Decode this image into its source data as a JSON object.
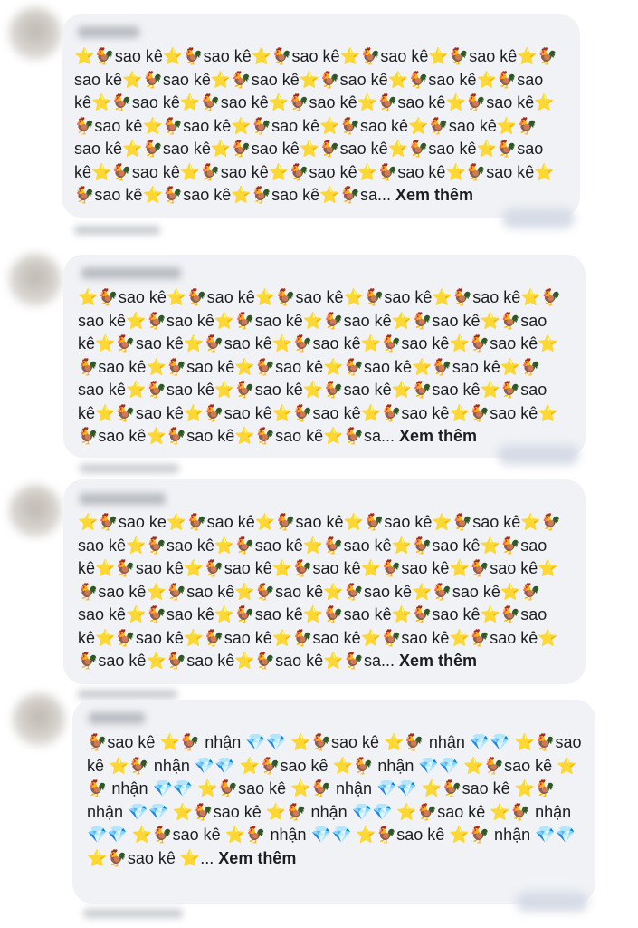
{
  "comments": [
    {
      "text": "⭐🐓sao kê⭐🐓sao kê⭐🐓sao kê⭐🐓sao kê⭐🐓sao kê⭐🐓sao kê⭐🐓sao kê⭐🐓sao kê⭐🐓sao kê⭐🐓sao kê⭐🐓sao kê⭐🐓sao kê⭐🐓sao kê⭐🐓sao kê⭐🐓sao kê⭐🐓sao kê⭐🐓sao kê⭐🐓sao kê⭐🐓sao kê⭐🐓sao kê⭐🐓sao kê⭐🐓sao kê⭐🐓sao kê⭐🐓sao kê⭐🐓sao kê⭐🐓sao kê⭐🐓sao kê⭐🐓sao kê⭐🐓sao kê⭐🐓sao kê⭐🐓sao kê⭐🐓sao kê⭐🐓sao kê⭐🐓sao kê⭐🐓sao kê⭐🐓sa...",
      "see_more": "Xem thêm"
    },
    {
      "text": "⭐🐓sao kê⭐🐓sao kê⭐🐓sao kê⭐🐓sao kê⭐🐓sao kê⭐🐓sao kê⭐🐓sao kê⭐🐓sao kê⭐🐓sao kê⭐🐓sao kê⭐🐓sao kê⭐🐓sao kê⭐🐓sao kê⭐🐓sao kê⭐🐓sao kê⭐🐓sao kê⭐🐓sao kê⭐🐓sao kê⭐🐓sao kê⭐🐓sao kê⭐🐓sao kê⭐🐓sao kê⭐🐓sao kê⭐🐓sao kê⭐🐓sao kê⭐🐓sao kê⭐🐓sao kê⭐🐓sao kê⭐🐓sao kê⭐🐓sao kê⭐🐓sao kê⭐🐓sao kê⭐🐓sao kê⭐🐓sao kê⭐🐓sao kê⭐🐓sa...",
      "see_more": "Xem thêm"
    },
    {
      "text": "⭐🐓sao ke⭐🐓sao kê⭐🐓sao kê⭐🐓sao kê⭐🐓sao kê⭐🐓sao kê⭐🐓sao kê⭐🐓sao kê⭐🐓sao kê⭐🐓sao kê⭐🐓sao kê⭐🐓sao kê⭐🐓sao kê⭐🐓sao kê⭐🐓sao kê⭐🐓sao kê⭐🐓sao kê⭐🐓sao kê⭐🐓sao kê⭐🐓sao kê⭐🐓sao kê⭐🐓sao kê⭐🐓sao kê⭐🐓sao kê⭐🐓sao kê⭐🐓sao kê⭐🐓sao kê⭐🐓sao kê⭐🐓sao kê⭐🐓sao kê⭐🐓sao kê⭐🐓sao kê⭐🐓sao kê⭐🐓sao kê⭐🐓sao kê⭐🐓sa...",
      "see_more": "Xem thêm"
    },
    {
      "text": "🐓sao kê ⭐🐓 nhận 💎💎 ⭐🐓sao kê ⭐🐓 nhận 💎💎 ⭐🐓sao kê ⭐🐓 nhận 💎💎 ⭐🐓sao kê ⭐🐓 nhận 💎💎 ⭐🐓sao kê ⭐🐓 nhận 💎💎 ⭐🐓sao kê ⭐🐓 nhận 💎💎 ⭐🐓sao kê ⭐🐓 nhận 💎💎 ⭐🐓sao kê ⭐🐓 nhận 💎💎 ⭐🐓sao kê ⭐🐓 nhận 💎💎 ⭐🐓sao kê ⭐🐓 nhận 💎💎 ⭐🐓sao kê ⭐🐓 nhận 💎💎 ⭐🐓sao kê ⭐...",
      "see_more": "Xem thêm"
    }
  ]
}
